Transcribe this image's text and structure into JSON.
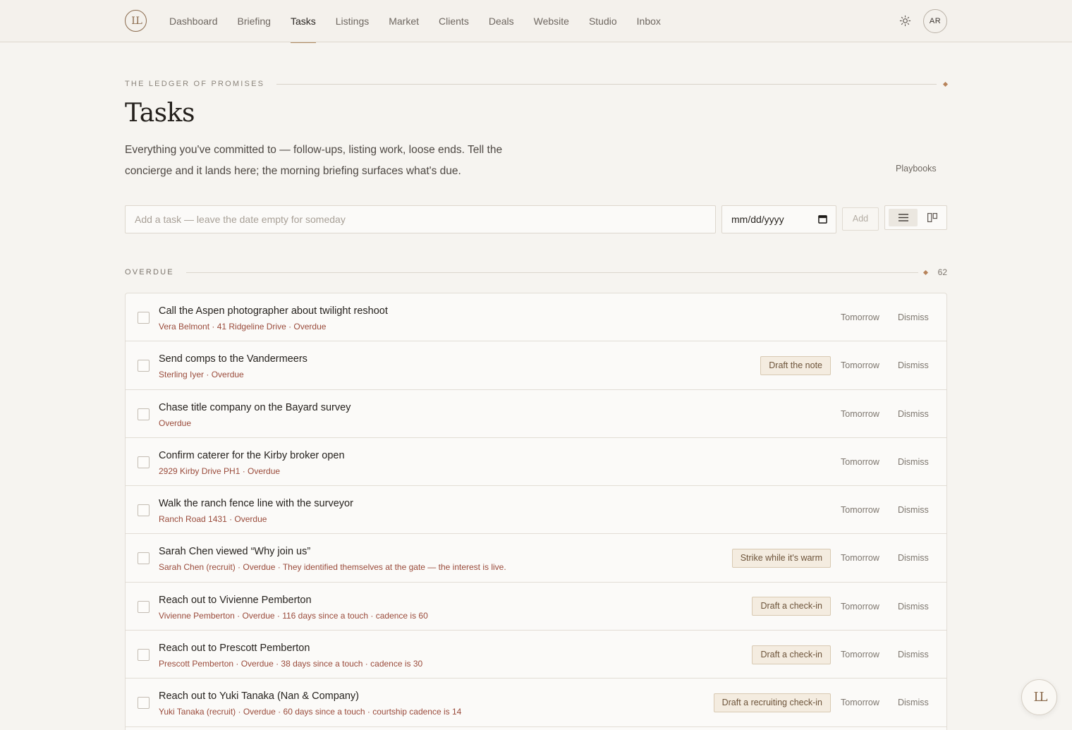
{
  "brand": {
    "logo_text": "LL"
  },
  "nav": {
    "items": [
      {
        "label": "Dashboard"
      },
      {
        "label": "Briefing"
      },
      {
        "label": "Tasks",
        "active": true
      },
      {
        "label": "Listings"
      },
      {
        "label": "Market"
      },
      {
        "label": "Clients"
      },
      {
        "label": "Deals"
      },
      {
        "label": "Website"
      },
      {
        "label": "Studio"
      },
      {
        "label": "Inbox"
      }
    ],
    "theme_icon": "sun-icon",
    "avatar_initials": "AR"
  },
  "header": {
    "eyebrow": "THE LEDGER OF PROMISES",
    "title": "Tasks",
    "intro": "Everything you've committed to — follow-ups, listing work, loose ends. Tell the concierge and it lands here; the morning briefing surfaces what's due.",
    "playbooks_label": "Playbooks"
  },
  "add_task": {
    "placeholder": "Add a task — leave the date empty for someday",
    "date_placeholder": "mm/dd/yyyy",
    "add_label": "Add",
    "view_icons": [
      "list-view-icon",
      "board-view-icon"
    ]
  },
  "section": {
    "label": "OVERDUE",
    "count": "62"
  },
  "tasks": [
    {
      "title": "Call the Aspen photographer about twilight reshoot",
      "meta": "Vera Belmont · 41 Ridgeline Drive · Overdue",
      "chip": "",
      "tomorrow": "Tomorrow",
      "dismiss": "Dismiss"
    },
    {
      "title": "Send comps to the Vandermeers",
      "meta": "Sterling Iyer · Overdue",
      "chip": "Draft the note",
      "tomorrow": "Tomorrow",
      "dismiss": "Dismiss"
    },
    {
      "title": "Chase title company on the Bayard survey",
      "meta": "Overdue",
      "chip": "",
      "tomorrow": "Tomorrow",
      "dismiss": "Dismiss"
    },
    {
      "title": "Confirm caterer for the Kirby broker open",
      "meta": "2929 Kirby Drive PH1 · Overdue",
      "chip": "",
      "tomorrow": "Tomorrow",
      "dismiss": "Dismiss"
    },
    {
      "title": "Walk the ranch fence line with the surveyor",
      "meta": "Ranch Road 1431 · Overdue",
      "chip": "",
      "tomorrow": "Tomorrow",
      "dismiss": "Dismiss"
    },
    {
      "title": "Sarah Chen viewed “Why join us”",
      "meta": "Sarah Chen (recruit) · Overdue · They identified themselves at the gate — the interest is live.",
      "chip": "Strike while it's warm",
      "tomorrow": "Tomorrow",
      "dismiss": "Dismiss"
    },
    {
      "title": "Reach out to Vivienne Pemberton",
      "meta": "Vivienne Pemberton · Overdue · 116 days since a touch · cadence is 60",
      "chip": "Draft a check-in",
      "tomorrow": "Tomorrow",
      "dismiss": "Dismiss"
    },
    {
      "title": "Reach out to Prescott Pemberton",
      "meta": "Prescott Pemberton · Overdue · 38 days since a touch · cadence is 30",
      "chip": "Draft a check-in",
      "tomorrow": "Tomorrow",
      "dismiss": "Dismiss"
    },
    {
      "title": "Reach out to Yuki Tanaka (Nan & Company)",
      "meta": "Yuki Tanaka (recruit) · Overdue · 60 days since a touch · courtship cadence is 14",
      "chip": "Draft a recruiting check-in",
      "tomorrow": "Tomorrow",
      "dismiss": "Dismiss"
    }
  ],
  "fab": {
    "label": "LL"
  }
}
